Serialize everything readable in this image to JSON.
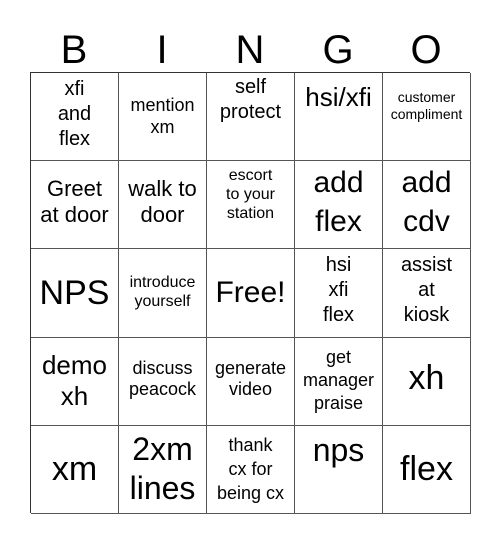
{
  "header": [
    "B",
    "I",
    "N",
    "G",
    "O"
  ],
  "cells": [
    [
      "xfi\nand\nflex",
      "mention\nxm",
      "self\nprotect",
      "hsi/xfi",
      "customer\ncompliment"
    ],
    [
      "Greet\nat door",
      "walk to\ndoor",
      "escort\nto your\nstation",
      "add\nflex",
      "add\ncdv"
    ],
    [
      "NPS",
      "introduce\nyourself",
      "Free!",
      "hsi\nxfi\nflex",
      "assist\nat\nkiosk"
    ],
    [
      "demo\nxh",
      "discuss\npeacock",
      "generate\nvideo",
      "get\nmanager\npraise",
      "xh"
    ],
    [
      "xm",
      "2xm\nlines",
      "thank\ncx for\nbeing cx",
      "nps",
      "flex"
    ]
  ]
}
